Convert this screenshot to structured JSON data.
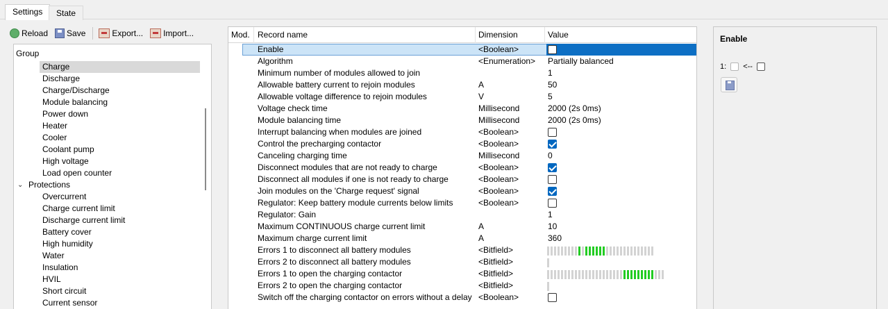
{
  "tabs": [
    {
      "label": "Settings"
    },
    {
      "label": "State"
    }
  ],
  "toolbar": {
    "reload": "Reload",
    "save": "Save",
    "export": "Export...",
    "import": "Import..."
  },
  "tree": {
    "header": "Group",
    "items": [
      {
        "label": "Charge"
      },
      {
        "label": "Discharge"
      },
      {
        "label": "Charge/Discharge"
      },
      {
        "label": "Module balancing"
      },
      {
        "label": "Power down"
      },
      {
        "label": "Heater"
      },
      {
        "label": "Cooler"
      },
      {
        "label": "Coolant pump"
      },
      {
        "label": "High voltage"
      },
      {
        "label": "Load open counter"
      },
      {
        "label": "Protections"
      },
      {
        "label": "Overcurrent"
      },
      {
        "label": "Charge current limit"
      },
      {
        "label": "Discharge current limit"
      },
      {
        "label": "Battery cover"
      },
      {
        "label": "High humidity"
      },
      {
        "label": "Water"
      },
      {
        "label": "Insulation"
      },
      {
        "label": "HVIL"
      },
      {
        "label": "Short circuit"
      },
      {
        "label": "Current sensor"
      }
    ]
  },
  "table": {
    "columns": {
      "mod": "Mod.",
      "name": "Record name",
      "dimension": "Dimension",
      "value": "Value"
    },
    "rows": [
      {
        "name": "Enable",
        "dimension": "<Boolean>",
        "value": "",
        "checkbox": false
      },
      {
        "name": "Algorithm",
        "dimension": "<Enumeration>",
        "value": "Partially balanced"
      },
      {
        "name": "Minimum number of modules allowed to join",
        "dimension": "",
        "value": "1"
      },
      {
        "name": "Allowable battery current to rejoin modules",
        "dimension": "A",
        "value": "50"
      },
      {
        "name": "Allowable voltage difference to rejoin modules",
        "dimension": "V",
        "value": "5"
      },
      {
        "name": "Voltage check time",
        "dimension": "Millisecond",
        "value": "2000 (2s 0ms)"
      },
      {
        "name": "Module balancing time",
        "dimension": "Millisecond",
        "value": "2000 (2s 0ms)"
      },
      {
        "name": "Interrupt balancing when modules are joined",
        "dimension": "<Boolean>",
        "value": "",
        "checkbox": false
      },
      {
        "name": "Control the precharging contactor",
        "dimension": "<Boolean>",
        "value": "",
        "checkbox": true
      },
      {
        "name": "Canceling charging time",
        "dimension": "Millisecond",
        "value": "0"
      },
      {
        "name": "Disconnect modules that are not ready to charge",
        "dimension": "<Boolean>",
        "value": "",
        "checkbox": true
      },
      {
        "name": "Disconnect all modules if one is not ready to charge",
        "dimension": "<Boolean>",
        "value": "",
        "checkbox": false
      },
      {
        "name": "Join modules on the 'Charge request' signal",
        "dimension": "<Boolean>",
        "value": "",
        "checkbox": true
      },
      {
        "name": "Regulator: Keep battery module currents below limits",
        "dimension": "<Boolean>",
        "value": "",
        "checkbox": false
      },
      {
        "name": "Regulator: Gain",
        "dimension": "",
        "value": "1"
      },
      {
        "name": "Maximum CONTINUOUS charge current limit",
        "dimension": "A",
        "value": "10"
      },
      {
        "name": "Maximum charge current limit",
        "dimension": "A",
        "value": "360"
      },
      {
        "name": "Errors 1 to disconnect all battery modules",
        "dimension": "<Bitfield>",
        "value": "",
        "bits": "0000000001011111100000000000000"
      },
      {
        "name": "Errors 2 to disconnect all battery modules",
        "dimension": "<Bitfield>",
        "value": "",
        "bits": "0"
      },
      {
        "name": "Errors 1 to open the charging contactor",
        "dimension": "<Bitfield>",
        "value": "",
        "bits": "0000000000000000000000111111111000"
      },
      {
        "name": "Errors 2 to open the charging contactor",
        "dimension": "<Bitfield>",
        "value": "",
        "bits": "0"
      },
      {
        "name": "Switch off the charging contactor on errors without a delay",
        "dimension": "<Boolean>",
        "value": "",
        "checkbox": false
      }
    ]
  },
  "detail": {
    "title": "Enable",
    "index_label": "1:",
    "arrow": "<--"
  }
}
